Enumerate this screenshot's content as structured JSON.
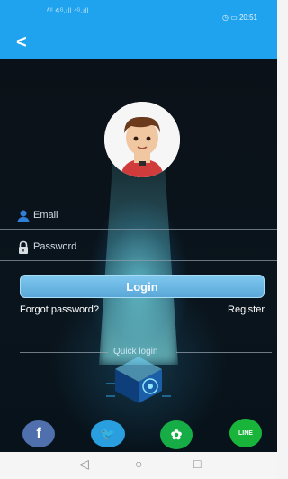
{
  "status": {
    "left": "ᴬᴵˡ 𝟰ᴳ.ıll ⁴ᴳ.ıll",
    "right": "◷ ▭ 20:51"
  },
  "appbar": {
    "back": "<"
  },
  "form": {
    "email_placeholder": "Email",
    "password_placeholder": "Password",
    "login_label": "Login",
    "forgot_label": "Forgot password?",
    "register_label": "Register"
  },
  "quick": {
    "label": "Quick login"
  },
  "social": {
    "facebook": "f",
    "twitter": "🐦",
    "wechat": "✿",
    "line": "LINE"
  },
  "nav": {
    "back": "◁",
    "home": "○",
    "recent": "□"
  },
  "colors": {
    "accent": "#1fa3ee",
    "login": "#6fb9e6"
  }
}
